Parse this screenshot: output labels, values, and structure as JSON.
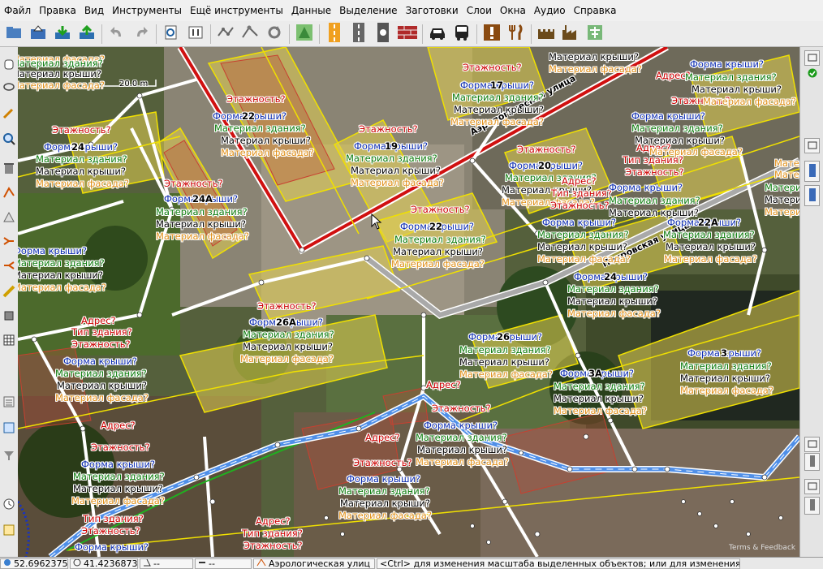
{
  "menu": [
    "Файл",
    "Правка",
    "Вид",
    "Инструменты",
    "Ещё инструменты",
    "Данные",
    "Выделение",
    "Заготовки",
    "Слои",
    "Окна",
    "Аудио",
    "Справка"
  ],
  "scale_label": "20.0 m",
  "streets": {
    "aerologic": "Аэрологическая улица",
    "pokrovskaya": "Покровская улица"
  },
  "labels": [
    {
      "t": "Этажность?",
      "c": "red"
    },
    {
      "t": "Материал крыши?",
      "c": "black"
    },
    {
      "t": "Материал фасада?",
      "c": "orange"
    },
    {
      "t": "Форма крыши?",
      "c": "blue"
    },
    {
      "t": "Материал здания?",
      "c": "green"
    },
    {
      "t": "Адрес?",
      "c": "red"
    },
    {
      "t": "Тип здания?",
      "c": "red"
    }
  ],
  "house_numbers": [
    "17",
    "19",
    "20",
    "22",
    "22",
    "22А",
    "24",
    "24",
    "24А",
    "26",
    "26А",
    "3",
    "3А"
  ],
  "attribution": "Terms & Feedback",
  "status": {
    "lat": "52.6962375",
    "lon": "41.4236873",
    "heading": "--",
    "distance": "--",
    "street": "Аэрологическая улиц",
    "hint": "<Ctrl> для изменения масштаба выделенных объектов; или для изменения выделения"
  },
  "colors": {
    "road_main": "#d01010",
    "road_yellow": "#f0e000",
    "road_blue": "#4f8fe8",
    "building_fill": "#e2d050"
  }
}
